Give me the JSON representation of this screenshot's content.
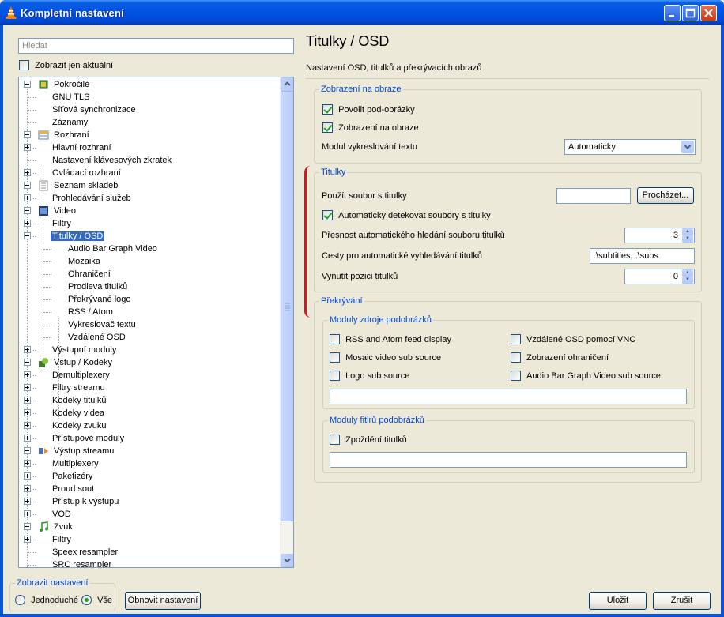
{
  "window": {
    "title": "Kompletní nastavení"
  },
  "left": {
    "search_placeholder": "Hledat",
    "only_current_label": "Zobrazit jen aktuální",
    "tree": [
      {
        "label": "Pokročilé",
        "level": 0,
        "expander": "minus",
        "icon": "chip-icon"
      },
      {
        "label": "GNU TLS",
        "level": 1,
        "expander": ""
      },
      {
        "label": "Síťová synchronizace",
        "level": 1,
        "expander": ""
      },
      {
        "label": "Záznamy",
        "level": 1,
        "expander": ""
      },
      {
        "label": "Rozhraní",
        "level": 0,
        "expander": "minus",
        "icon": "interface-icon"
      },
      {
        "label": "Hlavní rozhraní",
        "level": 1,
        "expander": "plus"
      },
      {
        "label": "Nastavení klávesových zkratek",
        "level": 1,
        "expander": ""
      },
      {
        "label": "Ovládací rozhraní",
        "level": 1,
        "expander": "plus"
      },
      {
        "label": "Seznam skladeb",
        "level": 0,
        "expander": "minus",
        "icon": "playlist-icon"
      },
      {
        "label": "Prohledávání služeb",
        "level": 1,
        "expander": "plus"
      },
      {
        "label": "Video",
        "level": 0,
        "expander": "minus",
        "icon": "film-icon"
      },
      {
        "label": "Filtry",
        "level": 1,
        "expander": "plus"
      },
      {
        "label": "Titulky / OSD",
        "level": 1,
        "expander": "minus",
        "selected": true
      },
      {
        "label": "Audio Bar Graph Video",
        "level": 2,
        "expander": ""
      },
      {
        "label": "Mozaika",
        "level": 2,
        "expander": ""
      },
      {
        "label": "Ohraničení",
        "level": 2,
        "expander": ""
      },
      {
        "label": "Prodleva titulků",
        "level": 2,
        "expander": ""
      },
      {
        "label": "Překrývané logo",
        "level": 2,
        "expander": ""
      },
      {
        "label": "RSS / Atom",
        "level": 2,
        "expander": ""
      },
      {
        "label": "Vykreslovač textu",
        "level": 2,
        "expander": ""
      },
      {
        "label": "Vzdálené OSD",
        "level": 2,
        "expander": ""
      },
      {
        "label": "Výstupní moduly",
        "level": 1,
        "expander": "plus"
      },
      {
        "label": "Vstup / Kodeky",
        "level": 0,
        "expander": "minus",
        "icon": "codec-icon"
      },
      {
        "label": "Demultiplexery",
        "level": 1,
        "expander": "plus"
      },
      {
        "label": "Filtry streamu",
        "level": 1,
        "expander": "plus"
      },
      {
        "label": "Kodeky titulků",
        "level": 1,
        "expander": "plus"
      },
      {
        "label": "Kodeky videa",
        "level": 1,
        "expander": "plus"
      },
      {
        "label": "Kodeky zvuku",
        "level": 1,
        "expander": "plus"
      },
      {
        "label": "Přístupové moduly",
        "level": 1,
        "expander": "plus"
      },
      {
        "label": "Výstup streamu",
        "level": 0,
        "expander": "minus",
        "icon": "stream-output-icon"
      },
      {
        "label": "Multiplexery",
        "level": 1,
        "expander": "plus"
      },
      {
        "label": "Paketizéry",
        "level": 1,
        "expander": "plus"
      },
      {
        "label": "Proud sout",
        "level": 1,
        "expander": "plus"
      },
      {
        "label": "Přístup k výstupu",
        "level": 1,
        "expander": "plus"
      },
      {
        "label": "VOD",
        "level": 1,
        "expander": "plus"
      },
      {
        "label": "Zvuk",
        "level": 0,
        "expander": "minus",
        "icon": "music-icon"
      },
      {
        "label": "Filtry",
        "level": 1,
        "expander": "plus"
      },
      {
        "label": "Speex resampler",
        "level": 1,
        "expander": ""
      },
      {
        "label": "SRC resampler",
        "level": 1,
        "expander": ""
      }
    ],
    "show_settings": {
      "legend": "Zobrazit nastavení",
      "simple": "Jednoduché",
      "all": "Vše",
      "selected": "all"
    },
    "reset_button": "Obnovit nastavení"
  },
  "panel": {
    "title": "Titulky / OSD",
    "description": "Nastavení OSD, titulků a překrývacích obrazů",
    "osd_group": {
      "legend": "Zobrazení na obraze",
      "enable_subpictures": "Povolit pod-obrázky",
      "enable_osd": "Zobrazení na obraze",
      "text_renderer_label": "Modul vykreslování textu",
      "text_renderer_value": "Automaticky"
    },
    "subs_group": {
      "legend": "Titulky",
      "use_file_label": "Použít soubor s titulky",
      "use_file_value": "",
      "browse_button": "Procházet...",
      "autodetect_label": "Automaticky detekovat soubory s titulky",
      "fuzzy_label": "Přesnost automatického hledání souboru titulků",
      "fuzzy_value": "3",
      "paths_label": "Cesty pro automatické vyhledávání titulků",
      "paths_value": ".\\subtitles, .\\subs",
      "position_label": "Vynutit pozici titulků",
      "position_value": "0"
    },
    "overlay_group": {
      "legend": "Překrývání",
      "sources": {
        "legend": "Moduly zdroje podobrázků",
        "items": [
          "RSS and Atom feed display",
          "Vzdálené OSD pomocí VNC",
          "Mosaic video sub source",
          "Zobrazení ohraničení",
          "Logo sub source",
          "Audio Bar Graph Video sub source"
        ],
        "text_value": ""
      },
      "filters": {
        "legend": "Moduly fitlrů podobrázků",
        "items": [
          "Zpoždění titulků"
        ],
        "text_value": ""
      }
    }
  },
  "footer": {
    "save_button": "Uložit",
    "cancel_button": "Zrušit"
  }
}
